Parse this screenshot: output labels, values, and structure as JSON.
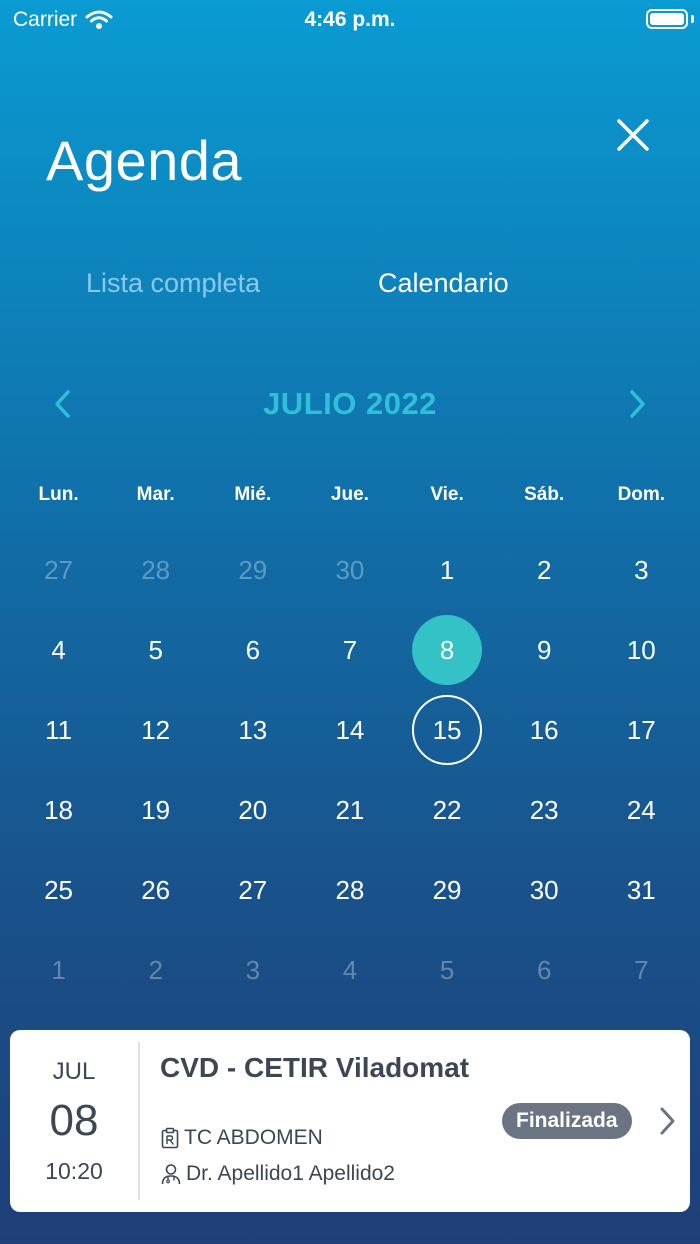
{
  "status_bar": {
    "carrier": "Carrier",
    "time": "4:46 p.m."
  },
  "header": {
    "title": "Agenda"
  },
  "tabs": [
    {
      "label": "Lista completa",
      "active": false
    },
    {
      "label": "Calendario",
      "active": true
    }
  ],
  "calendar": {
    "month_label": "JULIO 2022",
    "weekdays": [
      "Lun.",
      "Mar.",
      "Mié.",
      "Jue.",
      "Vie.",
      "Sáb.",
      "Dom."
    ],
    "weeks": [
      [
        {
          "d": "27",
          "muted": true
        },
        {
          "d": "28",
          "muted": true
        },
        {
          "d": "29",
          "muted": true
        },
        {
          "d": "30",
          "muted": true
        },
        {
          "d": "1"
        },
        {
          "d": "2"
        },
        {
          "d": "3"
        }
      ],
      [
        {
          "d": "4"
        },
        {
          "d": "5"
        },
        {
          "d": "6"
        },
        {
          "d": "7"
        },
        {
          "d": "8",
          "selected": true
        },
        {
          "d": "9"
        },
        {
          "d": "10"
        }
      ],
      [
        {
          "d": "11"
        },
        {
          "d": "12"
        },
        {
          "d": "13"
        },
        {
          "d": "14"
        },
        {
          "d": "15",
          "outlined": true
        },
        {
          "d": "16"
        },
        {
          "d": "17"
        }
      ],
      [
        {
          "d": "18"
        },
        {
          "d": "19"
        },
        {
          "d": "20"
        },
        {
          "d": "21"
        },
        {
          "d": "22"
        },
        {
          "d": "23"
        },
        {
          "d": "24"
        }
      ],
      [
        {
          "d": "25"
        },
        {
          "d": "26"
        },
        {
          "d": "27"
        },
        {
          "d": "28"
        },
        {
          "d": "29"
        },
        {
          "d": "30"
        },
        {
          "d": "31"
        }
      ],
      [
        {
          "d": "1",
          "muted": true
        },
        {
          "d": "2",
          "muted": true
        },
        {
          "d": "3",
          "muted": true
        },
        {
          "d": "4",
          "muted": true
        },
        {
          "d": "5",
          "muted": true
        },
        {
          "d": "6",
          "muted": true
        },
        {
          "d": "7",
          "muted": true
        }
      ]
    ]
  },
  "appointment": {
    "month": "JUL",
    "day": "08",
    "time": "10:20",
    "center": "CVD - CETIR Viladomat",
    "study_icon": "clipboard-rx-icon",
    "study": "TC ABDOMEN",
    "doctor_icon": "doctor-icon",
    "doctor": "Dr. Apellido1 Apellido2",
    "status": "Finalizada"
  },
  "colors": {
    "accent": "#33c2c6",
    "month_label": "#2fbfd8",
    "badge": "#6a7482",
    "card_text": "#3c4654"
  }
}
